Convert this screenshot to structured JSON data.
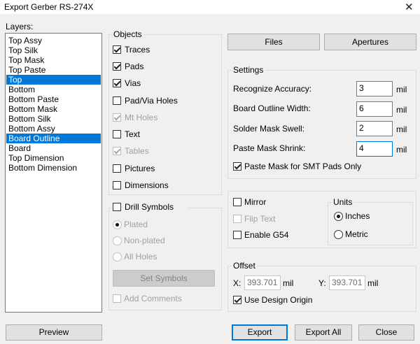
{
  "window": {
    "title": "Export Gerber RS-274X",
    "close_glyph": "✕"
  },
  "layers": {
    "label": "Layers:",
    "items": [
      "Top Assy",
      "Top Silk",
      "Top Mask",
      "Top Paste",
      "Top",
      "Bottom",
      "Bottom Paste",
      "Bottom Mask",
      "Bottom Silk",
      "Bottom Assy",
      "Board Outline",
      "Board",
      "Top Dimension",
      "Bottom Dimension"
    ],
    "selected": [
      "Top",
      "Board Outline"
    ]
  },
  "objects": {
    "label": "Objects",
    "items": [
      {
        "label": "Traces",
        "checked": true,
        "enabled": true
      },
      {
        "label": "Pads",
        "checked": true,
        "enabled": true
      },
      {
        "label": "Vias",
        "checked": true,
        "enabled": true
      },
      {
        "label": "Pad/Via Holes",
        "checked": false,
        "enabled": true
      },
      {
        "label": "Mt Holes",
        "checked": true,
        "enabled": false
      },
      {
        "label": "Text",
        "checked": false,
        "enabled": true
      },
      {
        "label": "Tables",
        "checked": true,
        "enabled": false
      },
      {
        "label": "Pictures",
        "checked": false,
        "enabled": true
      },
      {
        "label": "Dimensions",
        "checked": false,
        "enabled": true
      }
    ]
  },
  "drill": {
    "label": "Drill Symbols",
    "checked": false,
    "options": [
      "Plated",
      "Non-plated",
      "All Holes"
    ],
    "set_symbols_label": "Set Symbols",
    "add_comments_label": "Add Comments"
  },
  "buttons": {
    "files": "Files",
    "apertures": "Apertures",
    "preview": "Preview",
    "export": "Export",
    "export_all": "Export All",
    "close": "Close"
  },
  "settings": {
    "label": "Settings",
    "rows": [
      {
        "label": "Recognize Accuracy:",
        "value": "3",
        "unit": "mil"
      },
      {
        "label": "Board Outline Width:",
        "value": "6",
        "unit": "mil"
      },
      {
        "label": "Solder Mask Swell:",
        "value": "2",
        "unit": "mil"
      },
      {
        "label": "Paste Mask Shrink:",
        "value": "4",
        "unit": "mil"
      }
    ],
    "paste_smt_label": "Paste Mask for SMT Pads Only",
    "paste_smt_checked": true
  },
  "options": {
    "mirror": {
      "label": "Mirror",
      "checked": false
    },
    "flip_text": {
      "label": "Flip Text",
      "checked": false,
      "enabled": false
    },
    "enable_g54": {
      "label": "Enable G54",
      "checked": false
    }
  },
  "units": {
    "label": "Units",
    "options": [
      "Inches",
      "Metric"
    ],
    "selected": "Inches"
  },
  "offset": {
    "label": "Offset",
    "x_label": "X:",
    "x_value": "393.701",
    "y_label": "Y:",
    "y_value": "393.701",
    "unit": "mil",
    "use_origin_label": "Use Design Origin",
    "use_origin_checked": true
  }
}
